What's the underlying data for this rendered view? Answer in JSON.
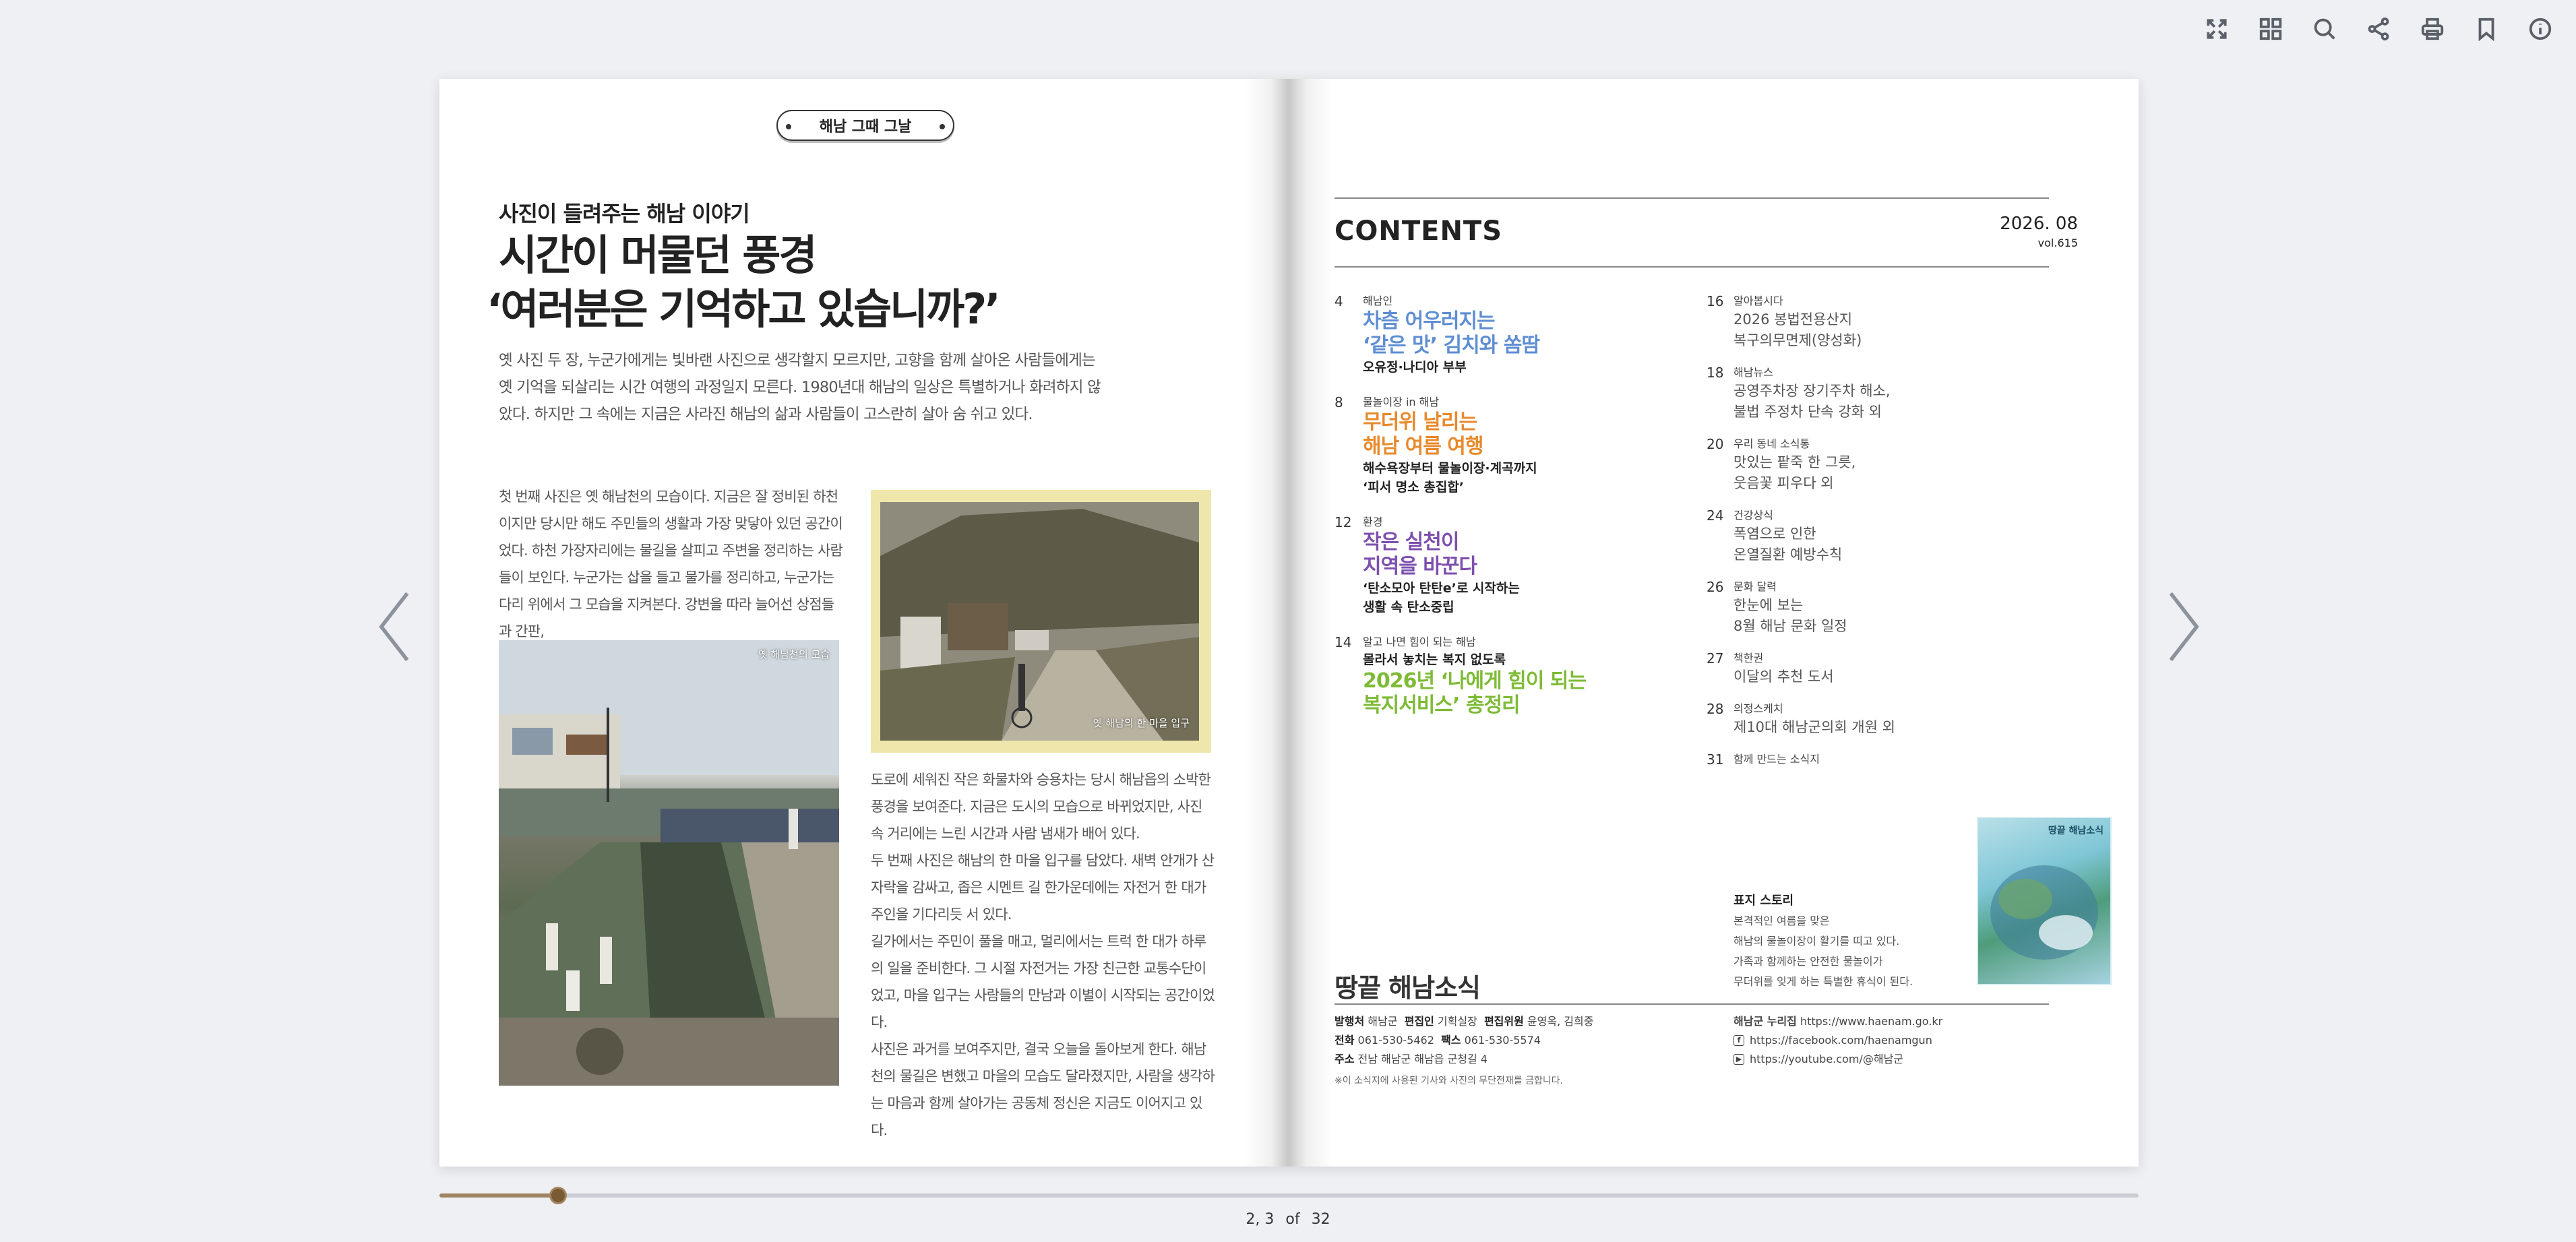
{
  "toolbar": {
    "icons": [
      "fullscreen-icon",
      "thumbnails-icon",
      "search-icon",
      "share-icon",
      "print-icon",
      "bookmark-icon",
      "info-icon"
    ]
  },
  "left_page": {
    "section_tag": "해남 그때 그날",
    "kicker": "사진이 들려주는 해남 이야기",
    "headline_1": "시간이 머물던 풍경",
    "headline_2": "‘여러분은 기억하고 있습니까?’",
    "lede": "옛 사진 두 장, 누군가에게는 빛바랜 사진으로 생각할지 모르지만, 고향을 함께 살아온 사람들에게는 옛 기억을 되살리는 시간 여행의 과정일지 모른다. 1980년대 해남의 일상은 특별하거나 화려하지 않았다. 하지만 그 속에는 지금은 사라진 해남의 삶과 사람들이 고스란히 살아 숨 쉬고 있다.",
    "body_col1": "첫 번째 사진은 옛 해남천의 모습이다. 지금은 잘 정비된 하천이지만 당시만 해도 주민들의 생활과 가장 맞닿아 있던 공간이었다. 하천 가장자리에는 물길을 살피고 주변을 정리하는 사람들이 보인다. 누군가는 삽을 들고 물가를 정리하고, 누군가는 다리 위에서 그 모습을 지켜본다. 강변을 따라 늘어선 상점들과 간판,",
    "body_col2_p1": "도로에 세워진 작은 화물차와 승용차는 당시 해남읍의 소박한 풍경을 보여준다. 지금은 도시의 모습으로 바뀌었지만, 사진 속 거리에는 느린 시간과 사람 냄새가 배어 있다.",
    "body_col2_p2": "두 번째 사진은 해남의 한 마을 입구를 담았다. 새벽 안개가 산자락을 감싸고, 좁은 시멘트 길 한가운데에는 자전거 한 대가 주인을 기다리듯 서 있다.",
    "body_col2_p3": "길가에서는 주민이 풀을 매고, 멀리에서는 트럭 한 대가 하루의 일을 준비한다. 그 시절 자전거는 가장 친근한 교통수단이었고, 마을 입구는 사람들의 만남과 이별이 시작되는 공간이었다.",
    "body_col2_p4": "사진은 과거를 보여주지만, 결국 오늘을 돌아보게 한다. 해남천의 물길은 변했고 마을의 모습도 달라졌지만, 사람을 생각하는 마음과 함께 살아가는 공동체 정신은 지금도 이어지고 있다.",
    "photo1_caption": "옛 해남천의 모습",
    "photo2_caption": "옛 해남의 한 마을 입구"
  },
  "right_page": {
    "contents_title": "CONTENTS",
    "issue_date": "2026. 08",
    "issue_vol": "vol.615",
    "toc_left": [
      {
        "num": "4",
        "cat": "해남인",
        "head_1": "차츰 어우러지는",
        "head_2": "‘같은 맛’ 김치와 쏨땀",
        "sub_1": "오유정·나디아 부부",
        "sub_2": ""
      },
      {
        "num": "8",
        "cat": "물놀이장 in 해남",
        "head_1": "무더위 날리는",
        "head_2": "해남 여름 여행",
        "sub_1": "해수욕장부터 물놀이장·계곡까지",
        "sub_2": "‘피서 명소 총집합’"
      },
      {
        "num": "12",
        "cat": "환경",
        "head_1": "작은 실천이",
        "head_2": "지역을 바꾼다",
        "sub_1": "‘탄소모아 탄탄e’로 시작하는",
        "sub_2": "생활 속 탄소중립"
      },
      {
        "num": "14",
        "cat": "알고 나면 힘이 되는 해남",
        "sub_1": "몰라서 놓치는 복지 없도록",
        "head_1": "2026년 ‘나에게 힘이 되는",
        "head_2": "복지서비스’ 총정리"
      }
    ],
    "toc_right": [
      {
        "num": "16",
        "cat": "알아봅시다",
        "line_1": "2026 봉법전용산지",
        "line_2": "복구의무면제(양성화)"
      },
      {
        "num": "18",
        "cat": "해남뉴스",
        "line_1": "공영주차장 장기주차 해소,",
        "line_2": "불법 주정차 단속 강화 외"
      },
      {
        "num": "20",
        "cat": "우리 동네 소식통",
        "line_1": "맛있는 팥죽 한 그릇,",
        "line_2": "웃음꽃 피우다 외"
      },
      {
        "num": "24",
        "cat": "건강상식",
        "line_1": "폭염으로 인한",
        "line_2": "온열질환 예방수칙"
      },
      {
        "num": "26",
        "cat": "문화 달력",
        "line_1": "한눈에 보는",
        "line_2": "8월 해남 문화 일정"
      },
      {
        "num": "27",
        "cat": "책한권",
        "line_1": "이달의 추천 도서",
        "line_2": ""
      },
      {
        "num": "28",
        "cat": "의정스케치",
        "line_1": "제10대 해남군의회 개원 외",
        "line_2": ""
      },
      {
        "num": "31",
        "cat": "함께 만드는 소식지",
        "line_1": "",
        "line_2": ""
      }
    ],
    "cover_story_title": "표지 스토리",
    "cover_story_1": "본격적인 여름을 맞은",
    "cover_story_2": "해남의 물놀이장이 활기를 띠고 있다.",
    "cover_story_3": "가족과 함께하는 안전한 물놀이가",
    "cover_story_4": "무더위를 잊게 하는 특별한 휴식이 된다.",
    "cover_thumb_title": "땅끝 해남소식",
    "brand_logo": "땅끝 해남소식",
    "publisher_label": "발행처",
    "publisher": "해남군",
    "editor_label": "편집인",
    "editor": "기획실장",
    "editorial_label": "편집위원",
    "editorial": "윤영옥, 김희중",
    "phone_label": "전화",
    "phone": "061-530-5462",
    "fax_label": "팩스",
    "fax": "061-530-5574",
    "address_label": "주소",
    "address": "전남 해남군 해남읍 군청길 4",
    "notice": "※이 소식지에 사용된 기사와 사진의 무단전재를 금합니다.",
    "web_label": "해남군 누리집",
    "web": "https://www.haenam.go.kr",
    "facebook": "https://facebook.com/haenamgun",
    "youtube": "https://youtube.com/@해남군"
  },
  "pager": {
    "current": "2, 3",
    "of": "of",
    "total": "32",
    "progress": 0.07
  }
}
